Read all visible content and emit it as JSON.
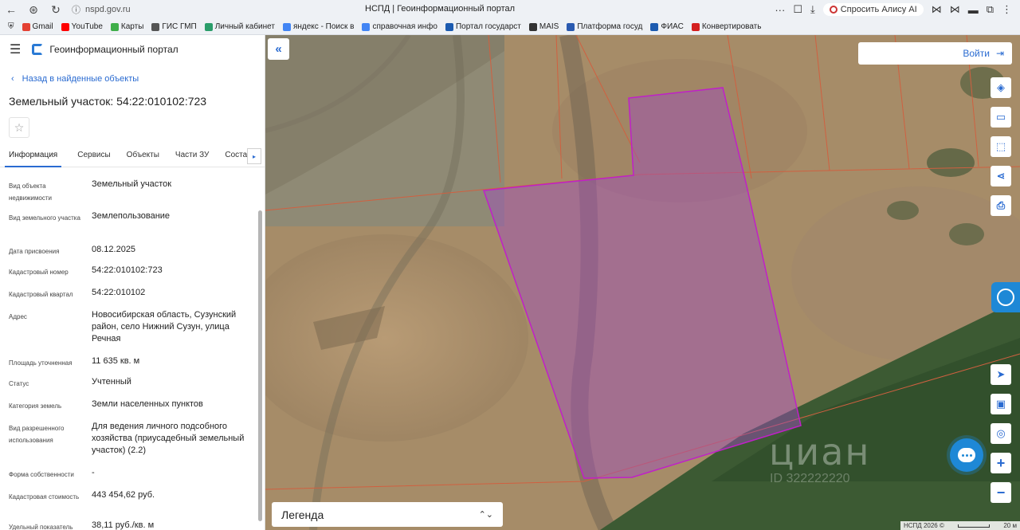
{
  "browser": {
    "url": "nspd.gov.ru",
    "page_title": "НСПД | Геоинформационный портал",
    "alisa": "Спросить Алису AI"
  },
  "bookmarks": [
    {
      "label": "Gmail",
      "color": "#e44133"
    },
    {
      "label": "YouTube",
      "color": "#ff0000"
    },
    {
      "label": "Карты",
      "color": "#3fae49"
    },
    {
      "label": "ГИС ГМП",
      "color": "#555555"
    },
    {
      "label": "Личный кабинет",
      "color": "#2a9d6a"
    },
    {
      "label": "яндекс - Поиск в",
      "color": "#4285f4"
    },
    {
      "label": "справочная инфо",
      "color": "#4285f4"
    },
    {
      "label": "Портал государст",
      "color": "#1c5bb0"
    },
    {
      "label": "MAIS",
      "color": "#333333"
    },
    {
      "label": "Платформа госуд",
      "color": "#2a5ab0"
    },
    {
      "label": "ФИАС",
      "color": "#1c5bb0"
    },
    {
      "label": "Конвертировать",
      "color": "#d42020"
    }
  ],
  "panel": {
    "portal_name": "Геоинформационный портал",
    "back_label": "Назад в найденные объекты",
    "object_title": "Земельный участок: 54:22:010102:723",
    "tabs": [
      "Информация",
      "Сервисы",
      "Объекты",
      "Части ЗУ",
      "Состав"
    ],
    "attributes": [
      {
        "label": "Вид объекта недвижимости",
        "value": "Земельный участок"
      },
      {
        "label": "Вид земельного участка",
        "value": "Землепользование"
      },
      {
        "label": "Дата присвоения",
        "value": "08.12.2025"
      },
      {
        "label": "Кадастровый номер",
        "value": "54:22:010102:723"
      },
      {
        "label": "Кадастровый квартал",
        "value": "54:22:010102"
      },
      {
        "label": "Адрес",
        "value": "Новосибирская область, Сузунский район, село Нижний Сузун, улица Речная"
      },
      {
        "label": "Площадь уточненная",
        "value": "11 635 кв. м"
      },
      {
        "label": "Статус",
        "value": "Учтенный"
      },
      {
        "label": "Категория земель",
        "value": "Земли населенных пунктов"
      },
      {
        "label": "Вид разрешенного использования",
        "value": "Для ведения личного подсобного хозяйства (приусадебный земельный участок) (2.2)"
      },
      {
        "label": "Форма собственности",
        "value": "-"
      },
      {
        "label": "Кадастровая стоимость",
        "value": "443 454,62 руб."
      },
      {
        "label": "Удельный показатель",
        "value": "38,11 руб./кв. м"
      }
    ]
  },
  "map": {
    "login_label": "Войти",
    "legend_label": "Легенда",
    "watermark": "циан",
    "watermark_id": "ID 322222220",
    "scale_left": "НСПД 2026 ©",
    "scale_right": "20 м",
    "parcel_fill": "#a04cbf",
    "parcel_stroke": "#c020c8",
    "accent": "#2a6bd1"
  }
}
